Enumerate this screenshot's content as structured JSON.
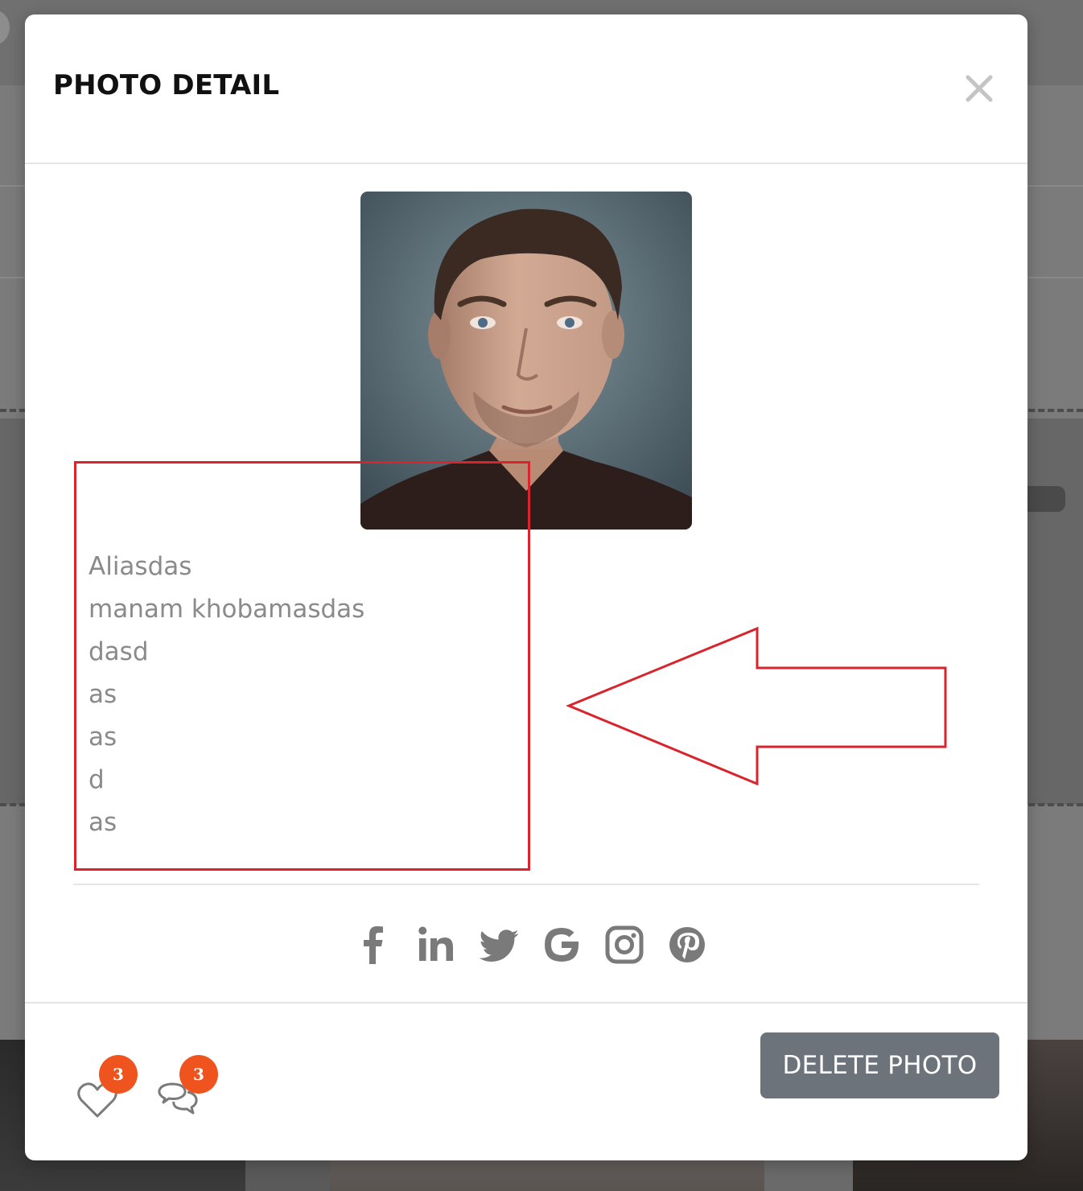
{
  "modal": {
    "title": "PHOTO DETAIL",
    "close_icon": "close-icon",
    "description_lines": [
      "Aliasdas",
      "manam khobamasdas",
      "dasd",
      "as",
      "as",
      "d",
      "as"
    ],
    "social_icons": [
      "facebook-icon",
      "linkedin-icon",
      "twitter-icon",
      "google-icon",
      "instagram-icon",
      "pinterest-icon"
    ],
    "footer": {
      "likes_count": "3",
      "comments_count": "3",
      "delete_label": "DELETE PHOTO"
    }
  },
  "colors": {
    "annotation": "#d9232d",
    "badge": "#f0541e",
    "delete_button": "#6d737b",
    "icon_gray": "#7a7a7a"
  }
}
